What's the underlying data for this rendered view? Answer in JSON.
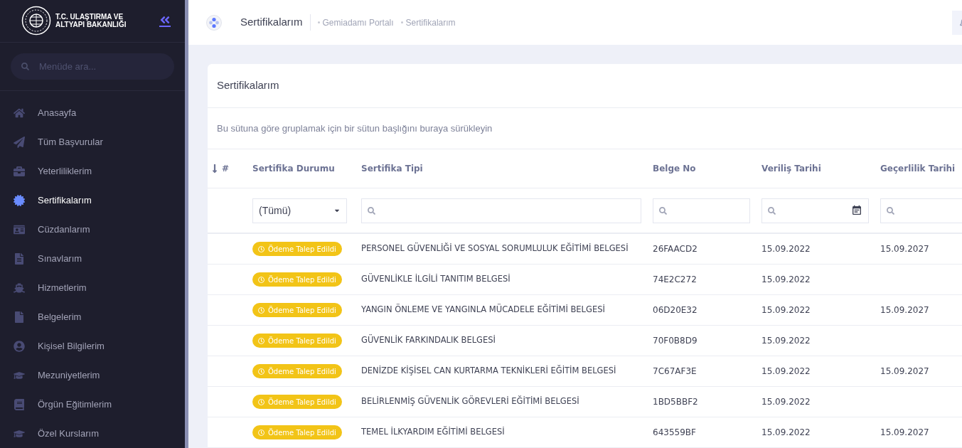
{
  "sidebar": {
    "logo_text": "T.C. ULAŞTIRMA VE ALTYAPI BAKANLIĞI",
    "search": {
      "placeholder": "Menüde ara..."
    },
    "items": [
      {
        "label": "Anasayfa",
        "selected": false
      },
      {
        "label": "Tüm Başvurular",
        "selected": false
      },
      {
        "label": "Yeterliliklerim",
        "selected": false
      },
      {
        "label": "Sertifikalarım",
        "selected": true
      },
      {
        "label": "Cüzdanlarım",
        "selected": false
      },
      {
        "label": "Sınavlarım",
        "selected": false
      },
      {
        "label": "Hizmetlerim",
        "selected": false
      },
      {
        "label": "Belgelerim",
        "selected": false
      },
      {
        "label": "Kişisel Bilgilerim",
        "selected": false
      },
      {
        "label": "Mezuniyetlerim",
        "selected": false
      },
      {
        "label": "Örgün Eğitimlerim",
        "selected": false
      },
      {
        "label": "Özel Kurslarım",
        "selected": false
      }
    ]
  },
  "header": {
    "title": "Sertifikalarım",
    "breadcrumbs": [
      "Gemiadamı Portalı",
      "Sertifikalarım"
    ]
  },
  "card": {
    "title": "Sertifikalarım",
    "group_panel": "Bu sütuna göre gruplamak için bir sütun başlığını buraya sürükleyin",
    "columns": [
      "#",
      "Sertifika Durumu",
      "Sertifika Tipi",
      "Belge No",
      "Veriliş Tarihi",
      "Geçerlilik Tarihi"
    ],
    "filters": [
      {
        "kind": "none"
      },
      {
        "kind": "select",
        "value": "(Tümü)"
      },
      {
        "kind": "search"
      },
      {
        "kind": "search"
      },
      {
        "kind": "date"
      },
      {
        "kind": "search"
      }
    ],
    "rows": [
      {
        "status": {
          "label": "Ödeme Talep Edildi",
          "kind": "warning"
        },
        "type": "PERSONEL GÜVENLİĞİ VE SOSYAL SORUMLULUK EĞİTİMİ BELGESİ",
        "no": "26FAACD2",
        "issued": "15.09.2022",
        "valid": "15.09.2027"
      },
      {
        "status": {
          "label": "Ödeme Talep Edildi",
          "kind": "warning"
        },
        "type": "GÜVENLİKLE İLGİLİ TANITIM BELGESİ",
        "no": "74E2C272",
        "issued": "15.09.2022"
      },
      {
        "status": {
          "label": "Ödeme Talep Edildi",
          "kind": "warning"
        },
        "type": "YANGIN ÖNLEME VE YANGINLA MÜCADELE EĞİTİMİ BELGESİ",
        "no": "06D20E32",
        "issued": "15.09.2022",
        "valid": "15.09.2027"
      },
      {
        "status": {
          "label": "Ödeme Talep Edildi",
          "kind": "warning"
        },
        "type": "GÜVENLİK FARKINDALIK BELGESİ",
        "no": "70F0B8D9",
        "issued": "15.09.2022"
      },
      {
        "status": {
          "label": "Ödeme Talep Edildi",
          "kind": "warning"
        },
        "type": "DENİZDE KİŞİSEL CAN KURTARMA TEKNİKLERİ EĞİTİM BELGESİ",
        "no": "7C67AF3E",
        "issued": "15.09.2022",
        "valid": "15.09.2027"
      },
      {
        "status": {
          "label": "Ödeme Talep Edildi",
          "kind": "warning"
        },
        "type": "BELİRLENMİŞ GÜVENLİK GÖREVLERİ EĞİTİMİ BELGESİ",
        "no": "1BD5BBF2",
        "issued": "15.09.2022"
      },
      {
        "status": {
          "label": "Ödeme Talep Edildi",
          "kind": "warning"
        },
        "type": "TEMEL İLKYARDIM EĞİTİMİ BELGESİ",
        "no": "643559BF",
        "issued": "15.09.2022",
        "valid": "15.09.2027"
      }
    ]
  }
}
